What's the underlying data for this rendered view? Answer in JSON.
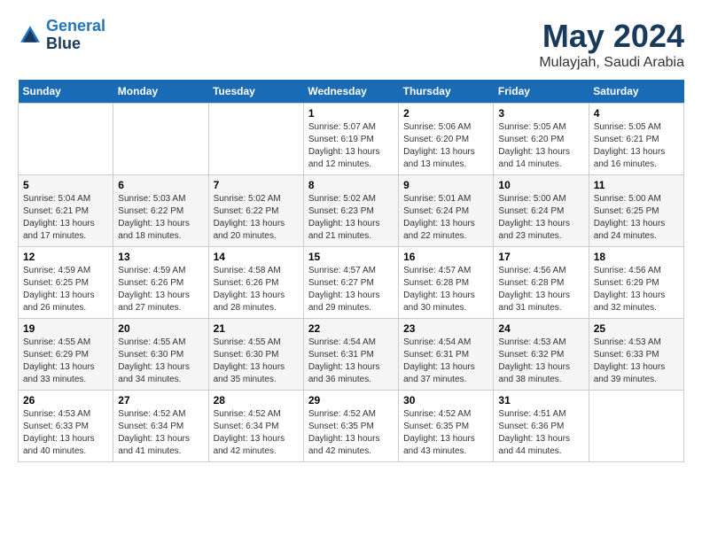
{
  "header": {
    "logo_line1": "General",
    "logo_line2": "Blue",
    "title": "May 2024",
    "subtitle": "Mulayjah, Saudi Arabia"
  },
  "weekdays": [
    "Sunday",
    "Monday",
    "Tuesday",
    "Wednesday",
    "Thursday",
    "Friday",
    "Saturday"
  ],
  "rows": [
    [
      {
        "day": "",
        "info": ""
      },
      {
        "day": "",
        "info": ""
      },
      {
        "day": "",
        "info": ""
      },
      {
        "day": "1",
        "info": "Sunrise: 5:07 AM\nSunset: 6:19 PM\nDaylight: 13 hours\nand 12 minutes."
      },
      {
        "day": "2",
        "info": "Sunrise: 5:06 AM\nSunset: 6:20 PM\nDaylight: 13 hours\nand 13 minutes."
      },
      {
        "day": "3",
        "info": "Sunrise: 5:05 AM\nSunset: 6:20 PM\nDaylight: 13 hours\nand 14 minutes."
      },
      {
        "day": "4",
        "info": "Sunrise: 5:05 AM\nSunset: 6:21 PM\nDaylight: 13 hours\nand 16 minutes."
      }
    ],
    [
      {
        "day": "5",
        "info": "Sunrise: 5:04 AM\nSunset: 6:21 PM\nDaylight: 13 hours\nand 17 minutes."
      },
      {
        "day": "6",
        "info": "Sunrise: 5:03 AM\nSunset: 6:22 PM\nDaylight: 13 hours\nand 18 minutes."
      },
      {
        "day": "7",
        "info": "Sunrise: 5:02 AM\nSunset: 6:22 PM\nDaylight: 13 hours\nand 20 minutes."
      },
      {
        "day": "8",
        "info": "Sunrise: 5:02 AM\nSunset: 6:23 PM\nDaylight: 13 hours\nand 21 minutes."
      },
      {
        "day": "9",
        "info": "Sunrise: 5:01 AM\nSunset: 6:24 PM\nDaylight: 13 hours\nand 22 minutes."
      },
      {
        "day": "10",
        "info": "Sunrise: 5:00 AM\nSunset: 6:24 PM\nDaylight: 13 hours\nand 23 minutes."
      },
      {
        "day": "11",
        "info": "Sunrise: 5:00 AM\nSunset: 6:25 PM\nDaylight: 13 hours\nand 24 minutes."
      }
    ],
    [
      {
        "day": "12",
        "info": "Sunrise: 4:59 AM\nSunset: 6:25 PM\nDaylight: 13 hours\nand 26 minutes."
      },
      {
        "day": "13",
        "info": "Sunrise: 4:59 AM\nSunset: 6:26 PM\nDaylight: 13 hours\nand 27 minutes."
      },
      {
        "day": "14",
        "info": "Sunrise: 4:58 AM\nSunset: 6:26 PM\nDaylight: 13 hours\nand 28 minutes."
      },
      {
        "day": "15",
        "info": "Sunrise: 4:57 AM\nSunset: 6:27 PM\nDaylight: 13 hours\nand 29 minutes."
      },
      {
        "day": "16",
        "info": "Sunrise: 4:57 AM\nSunset: 6:28 PM\nDaylight: 13 hours\nand 30 minutes."
      },
      {
        "day": "17",
        "info": "Sunrise: 4:56 AM\nSunset: 6:28 PM\nDaylight: 13 hours\nand 31 minutes."
      },
      {
        "day": "18",
        "info": "Sunrise: 4:56 AM\nSunset: 6:29 PM\nDaylight: 13 hours\nand 32 minutes."
      }
    ],
    [
      {
        "day": "19",
        "info": "Sunrise: 4:55 AM\nSunset: 6:29 PM\nDaylight: 13 hours\nand 33 minutes."
      },
      {
        "day": "20",
        "info": "Sunrise: 4:55 AM\nSunset: 6:30 PM\nDaylight: 13 hours\nand 34 minutes."
      },
      {
        "day": "21",
        "info": "Sunrise: 4:55 AM\nSunset: 6:30 PM\nDaylight: 13 hours\nand 35 minutes."
      },
      {
        "day": "22",
        "info": "Sunrise: 4:54 AM\nSunset: 6:31 PM\nDaylight: 13 hours\nand 36 minutes."
      },
      {
        "day": "23",
        "info": "Sunrise: 4:54 AM\nSunset: 6:31 PM\nDaylight: 13 hours\nand 37 minutes."
      },
      {
        "day": "24",
        "info": "Sunrise: 4:53 AM\nSunset: 6:32 PM\nDaylight: 13 hours\nand 38 minutes."
      },
      {
        "day": "25",
        "info": "Sunrise: 4:53 AM\nSunset: 6:33 PM\nDaylight: 13 hours\nand 39 minutes."
      }
    ],
    [
      {
        "day": "26",
        "info": "Sunrise: 4:53 AM\nSunset: 6:33 PM\nDaylight: 13 hours\nand 40 minutes."
      },
      {
        "day": "27",
        "info": "Sunrise: 4:52 AM\nSunset: 6:34 PM\nDaylight: 13 hours\nand 41 minutes."
      },
      {
        "day": "28",
        "info": "Sunrise: 4:52 AM\nSunset: 6:34 PM\nDaylight: 13 hours\nand 42 minutes."
      },
      {
        "day": "29",
        "info": "Sunrise: 4:52 AM\nSunset: 6:35 PM\nDaylight: 13 hours\nand 42 minutes."
      },
      {
        "day": "30",
        "info": "Sunrise: 4:52 AM\nSunset: 6:35 PM\nDaylight: 13 hours\nand 43 minutes."
      },
      {
        "day": "31",
        "info": "Sunrise: 4:51 AM\nSunset: 6:36 PM\nDaylight: 13 hours\nand 44 minutes."
      },
      {
        "day": "",
        "info": ""
      }
    ]
  ]
}
